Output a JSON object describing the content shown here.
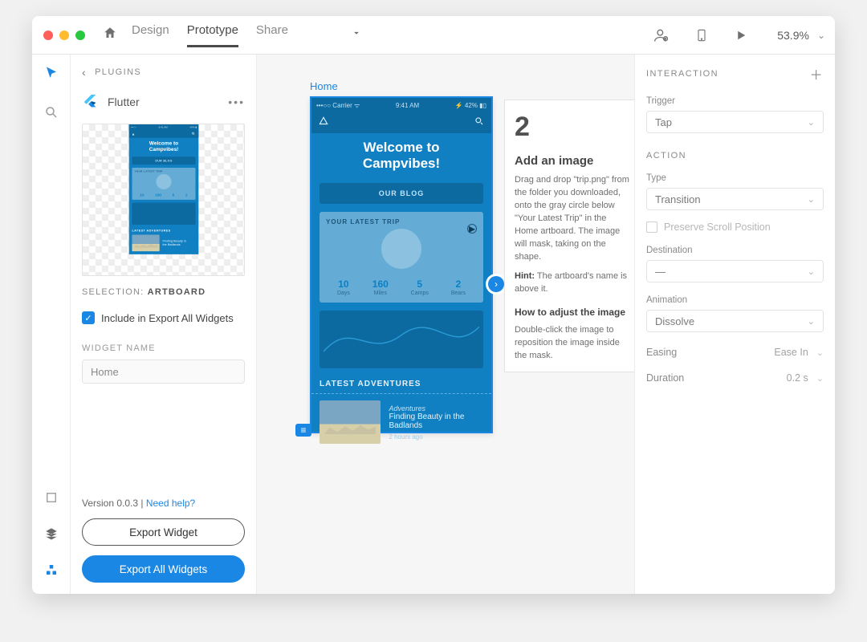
{
  "topbar": {
    "tabs": {
      "design": "Design",
      "prototype": "Prototype",
      "share": "Share"
    },
    "zoom": "53.9%"
  },
  "plugin": {
    "header": "PLUGINS",
    "app_name": "Flutter",
    "selection_prefix": "SELECTION:",
    "selection_value": "ARTBOARD",
    "include_label": "Include in Export All Widgets",
    "widget_name_label": "WIDGET NAME",
    "widget_name_value": "Home",
    "version_prefix": "Version 0.0.3  |  ",
    "help_link": "Need help?",
    "export_one": "Export Widget",
    "export_all": "Export All Widgets"
  },
  "artboard": {
    "label": "Home",
    "status": {
      "carrier": "•••○○ Carrier  ᯤ",
      "time": "9:41 AM",
      "batt": "⚡ 42% ▮▯"
    },
    "welcome_line1": "Welcome to",
    "welcome_line2": "Campvibes!",
    "blog_btn": "OUR BLOG",
    "trip_title": "YOUR LATEST TRIP",
    "stats": [
      {
        "num": "10",
        "lab": "Days"
      },
      {
        "num": "160",
        "lab": "Miles"
      },
      {
        "num": "5",
        "lab": "Camps"
      },
      {
        "num": "2",
        "lab": "Bears"
      }
    ],
    "latest_hdr": "LATEST ADVENTURES",
    "adventure": {
      "category": "Adventures",
      "title": "Finding Beauty in the Badlands",
      "time": "2 hours ago"
    }
  },
  "tutorial": {
    "num": "2",
    "h2": "Add an image",
    "body": "Drag and drop \"trip.png\" from the folder you downloaded, onto the gray circle below \"Your Latest Trip\" in the Home artboard. The image will mask, taking on the shape.",
    "hint_label": "Hint:",
    "hint": " The artboard's name is above it.",
    "how": "How to adjust the image",
    "how_body": "Double-click the image to reposition the image inside the mask."
  },
  "inspector": {
    "header": "INTERACTION",
    "trigger_label": "Trigger",
    "trigger_value": "Tap",
    "action_label": "ACTION",
    "type_label": "Type",
    "type_value": "Transition",
    "preserve": "Preserve Scroll Position",
    "destination_label": "Destination",
    "destination_value": "—",
    "animation_label": "Animation",
    "animation_value": "Dissolve",
    "easing_label": "Easing",
    "easing_value": "Ease In",
    "duration_label": "Duration",
    "duration_value": "0.2 s"
  }
}
